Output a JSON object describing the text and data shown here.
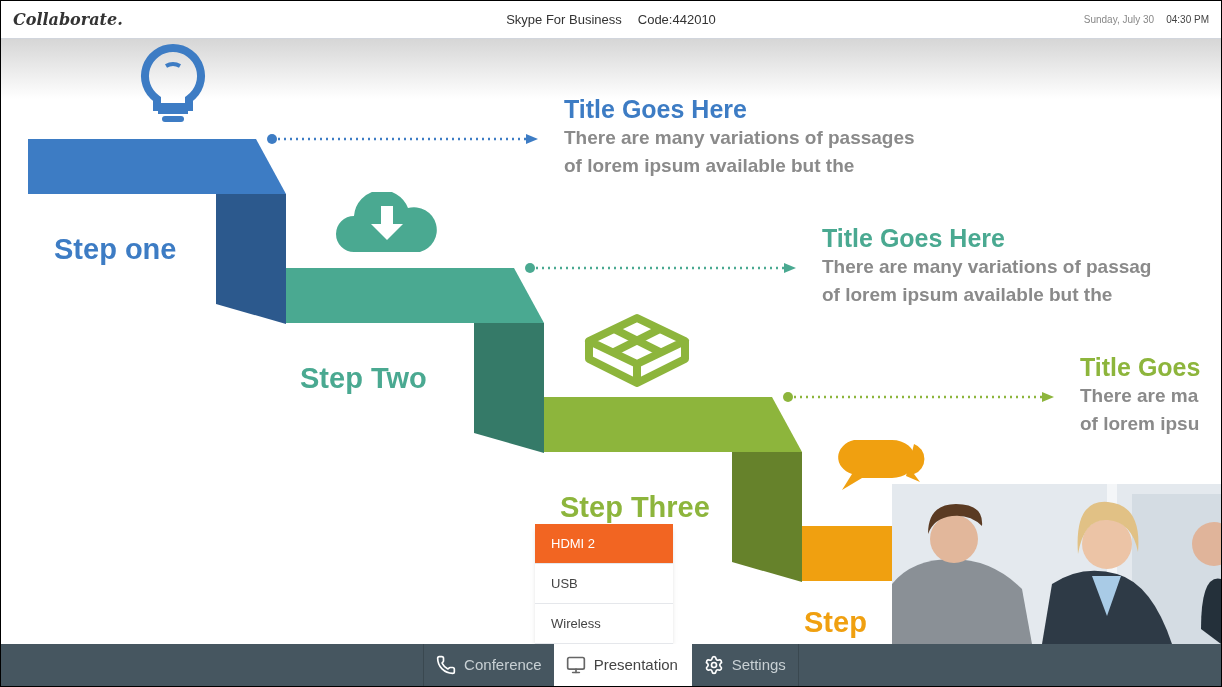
{
  "header": {
    "logo": "Collaborate.",
    "service": "Skype For Business",
    "code": "Code:442010",
    "date": "Sunday, July 30",
    "time": "04:30 PM"
  },
  "slide": {
    "steps": [
      {
        "label": "Step one",
        "color": "#3d7cc4",
        "title": "Title Goes Here",
        "lines": [
          "There are many variations of passages",
          "of lorem ipsum available but the"
        ]
      },
      {
        "label": "Step Two",
        "color": "#4aa991",
        "title": "Title Goes Here",
        "lines": [
          "There are many variations of passag",
          "of lorem ipsum available but the"
        ]
      },
      {
        "label": "Step Three",
        "color": "#8db53c",
        "title": "Title Goes",
        "lines": [
          "There are ma",
          "of lorem ipsu"
        ]
      },
      {
        "label": "Step",
        "color": "#f0a010"
      }
    ]
  },
  "source_menu": [
    {
      "label": "HDMI 2",
      "selected": true
    },
    {
      "label": "USB",
      "selected": false
    },
    {
      "label": "Wireless",
      "selected": false
    }
  ],
  "nav": [
    {
      "label": "Conference",
      "kind": "phone",
      "selected": false
    },
    {
      "label": "Presentation",
      "kind": "monitor",
      "selected": true
    },
    {
      "label": "Settings",
      "kind": "gear",
      "selected": false
    }
  ]
}
